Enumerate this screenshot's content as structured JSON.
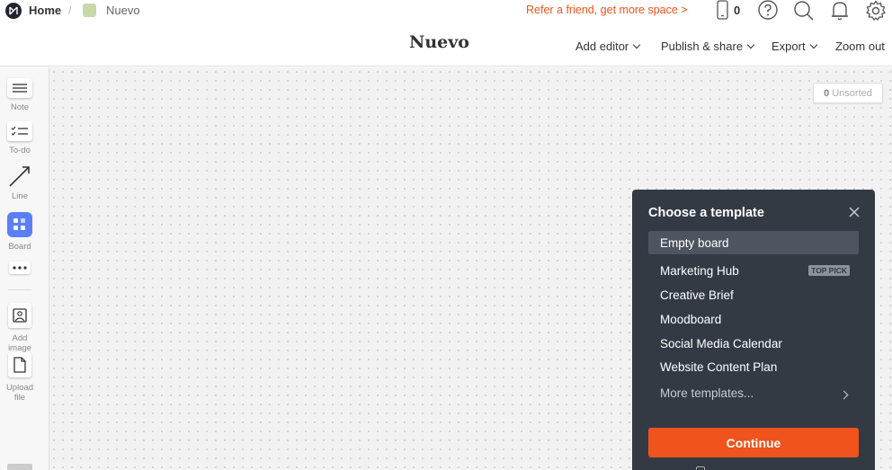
{
  "breadcrumb": {
    "home": "Home",
    "separator": "/",
    "board": "Nuevo"
  },
  "header": {
    "refer": "Refer a friend, get more space >",
    "phone_count": "0",
    "title": "Nuevo",
    "menu": {
      "add_editor": "Add editor",
      "publish_share": "Publish & share",
      "export": "Export",
      "zoom_out": "Zoom out"
    }
  },
  "sidebar": {
    "note": "Note",
    "todo": "To-do",
    "line": "Line",
    "board": "Board",
    "add_image": "Add image",
    "upload_file": "Upload file"
  },
  "canvas": {
    "unsorted_count": "0",
    "unsorted_label": "Unsorted"
  },
  "template_panel": {
    "title": "Choose a template",
    "items": [
      {
        "label": "Empty board"
      },
      {
        "label": "Marketing Hub",
        "badge": "TOP PICK"
      },
      {
        "label": "Creative Brief"
      },
      {
        "label": "Moodboard"
      },
      {
        "label": "Social Media Calendar"
      },
      {
        "label": "Website Content Plan"
      }
    ],
    "more": "More templates...",
    "continue": "Continue"
  },
  "colors": {
    "accent": "#f0531c",
    "panel_bg": "#333a44",
    "board_tool": "#5b7ff7"
  }
}
